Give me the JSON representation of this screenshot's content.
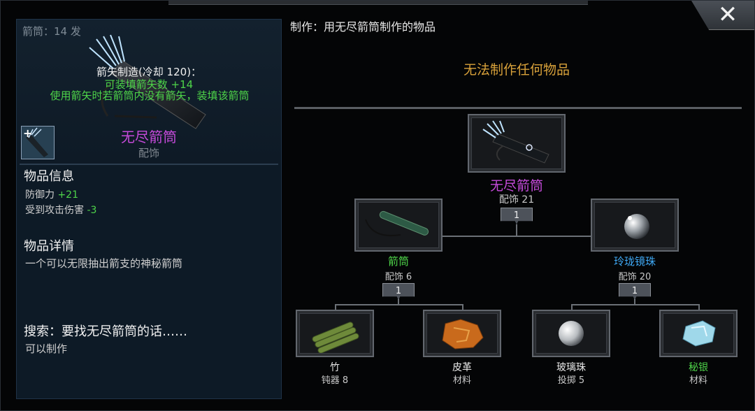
{
  "left": {
    "ammo_count": "箭筒：14 发",
    "craft_title": "箭矢制造(冷却 120)：",
    "craft_line1": "可装填箭矢数 +14",
    "craft_line2": "使用箭矢时若箭筒内没有箭矢，装填该箭筒",
    "item_name": "无尽箭筒",
    "item_type": "配饰",
    "info_heading": "物品信息",
    "stats": [
      {
        "label": "防御力",
        "value": "+21"
      },
      {
        "label": "受到攻击伤害",
        "value": "-3"
      }
    ],
    "detail_heading": "物品详情",
    "detail_text": "一个可以无限抽出箭支的神秘箭筒",
    "search_heading": "搜索：要找无尽箭筒的话……",
    "search_text": "可以制作"
  },
  "right": {
    "title": "制作：用无尽箭筒制作的物品",
    "cannot_craft": "无法制作任何物品"
  },
  "tree": {
    "root": {
      "name": "无尽箭筒",
      "sub": "配饰 21",
      "count": "1",
      "icon": "quiver-icon",
      "color": "#c44ad9"
    },
    "left": {
      "name": "箭筒",
      "sub": "配饰 6",
      "count": "1",
      "icon": "tube-quiver-icon",
      "color": "#4ed449"
    },
    "right": {
      "name": "玲珑镜珠",
      "sub": "配饰 20",
      "count": "1",
      "icon": "mirror-orb-icon",
      "color": "#3fa9f5"
    },
    "leaves": [
      {
        "name": "竹",
        "sub": "钝器 8",
        "icon": "bamboo-icon",
        "color": "#e8e8e8"
      },
      {
        "name": "皮革",
        "sub": "材料",
        "icon": "leather-icon",
        "color": "#e8e8e8"
      },
      {
        "name": "玻璃珠",
        "sub": "投掷 5",
        "icon": "glass-bead-icon",
        "color": "#e8e8e8"
      },
      {
        "name": "秘银",
        "sub": "材料",
        "icon": "mithril-icon",
        "color": "#4ed449"
      }
    ]
  },
  "close_label": "✕"
}
